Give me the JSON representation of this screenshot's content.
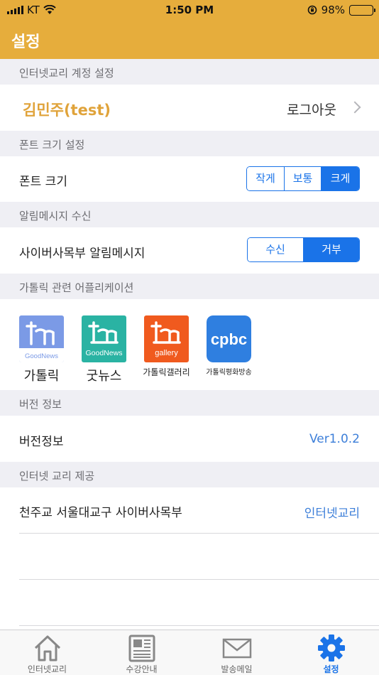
{
  "status_bar": {
    "carrier": "KT",
    "time": "1:50 PM",
    "battery_percent": "98%",
    "battery_level": 0.98
  },
  "nav": {
    "title": "설정"
  },
  "sections": {
    "account": "인터넷교리 계정 설정",
    "font_size": "폰트 크기 설정",
    "notifications": "알림메시지 수신",
    "apps": "가톨릭 관련 어플리케이션",
    "version": "버전 정보",
    "provider": "인터넷 교리 제공"
  },
  "account": {
    "name": "김민주(test)",
    "logout_label": "로그아웃"
  },
  "font_size": {
    "label": "폰트 크기",
    "options": [
      "작게",
      "보통",
      "크게"
    ],
    "selected": "크게"
  },
  "notifications": {
    "label": "사이버사목부 알림메시지",
    "options": [
      "수신",
      "거부"
    ],
    "selected": "거부"
  },
  "apps": [
    {
      "label": "가톨릭",
      "icon_text": "GoodNews",
      "color": "#7b9ae6"
    },
    {
      "label": "굿뉴스",
      "icon_text": "GoodNews",
      "color": "#2ab3a3"
    },
    {
      "label": "가톨릭갤러리",
      "icon_text": "gallery",
      "color": "#f05a1e"
    },
    {
      "label": "가톨릭평화방송",
      "icon_text": "cpbc",
      "color": "#2f7fe0"
    }
  ],
  "version": {
    "label": "버전정보",
    "value": "Ver1.0.2"
  },
  "provider": {
    "label": "천주교 서울대교구 사이버사목부",
    "value": "인터넷교리"
  },
  "tabs": [
    {
      "label": "인터넷교리",
      "icon": "home-icon",
      "active": false
    },
    {
      "label": "수강안내",
      "icon": "newspaper-icon",
      "active": false
    },
    {
      "label": "발송메일",
      "icon": "mail-icon",
      "active": false
    },
    {
      "label": "설정",
      "icon": "gear-icon",
      "active": true
    }
  ],
  "colors": {
    "header": "#e6ad3c",
    "accent": "#1a73e8",
    "account_name": "#e0a33a",
    "link": "#3d7fd9"
  }
}
